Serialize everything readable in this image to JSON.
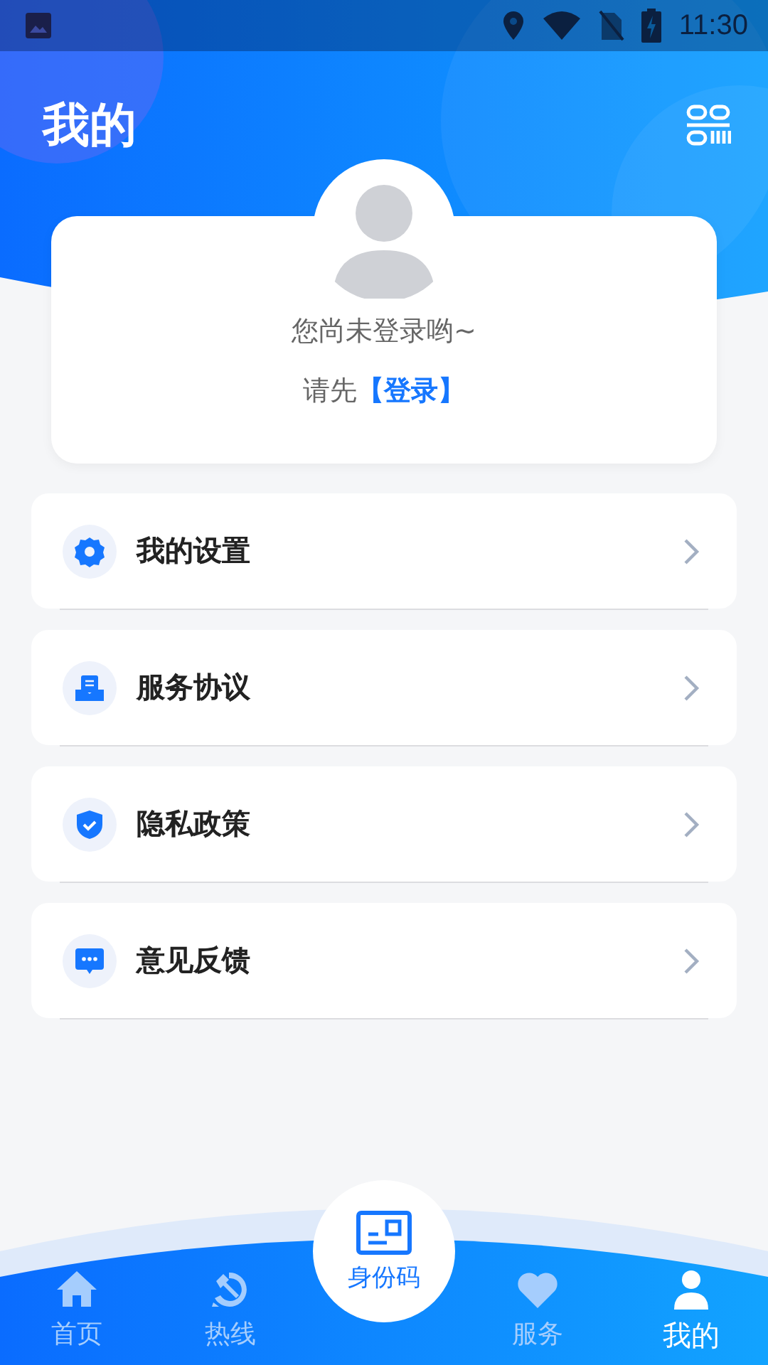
{
  "status_bar": {
    "time": "11:30"
  },
  "header": {
    "title": "我的"
  },
  "profile": {
    "message": "您尚未登录哟~",
    "prompt": "请先",
    "login_link": "【登录】"
  },
  "menu": [
    {
      "label": "我的设置"
    },
    {
      "label": "服务协议"
    },
    {
      "label": "隐私政策"
    },
    {
      "label": "意见反馈"
    }
  ],
  "bottom_nav": [
    {
      "label": "首页",
      "kind": "tab",
      "selected": false
    },
    {
      "label": "热线",
      "kind": "tab",
      "selected": false
    },
    {
      "label": "身份码",
      "kind": "center",
      "selected": false
    },
    {
      "label": "服务",
      "kind": "tab",
      "selected": false
    },
    {
      "label": "我的",
      "kind": "tab",
      "selected": true
    }
  ]
}
